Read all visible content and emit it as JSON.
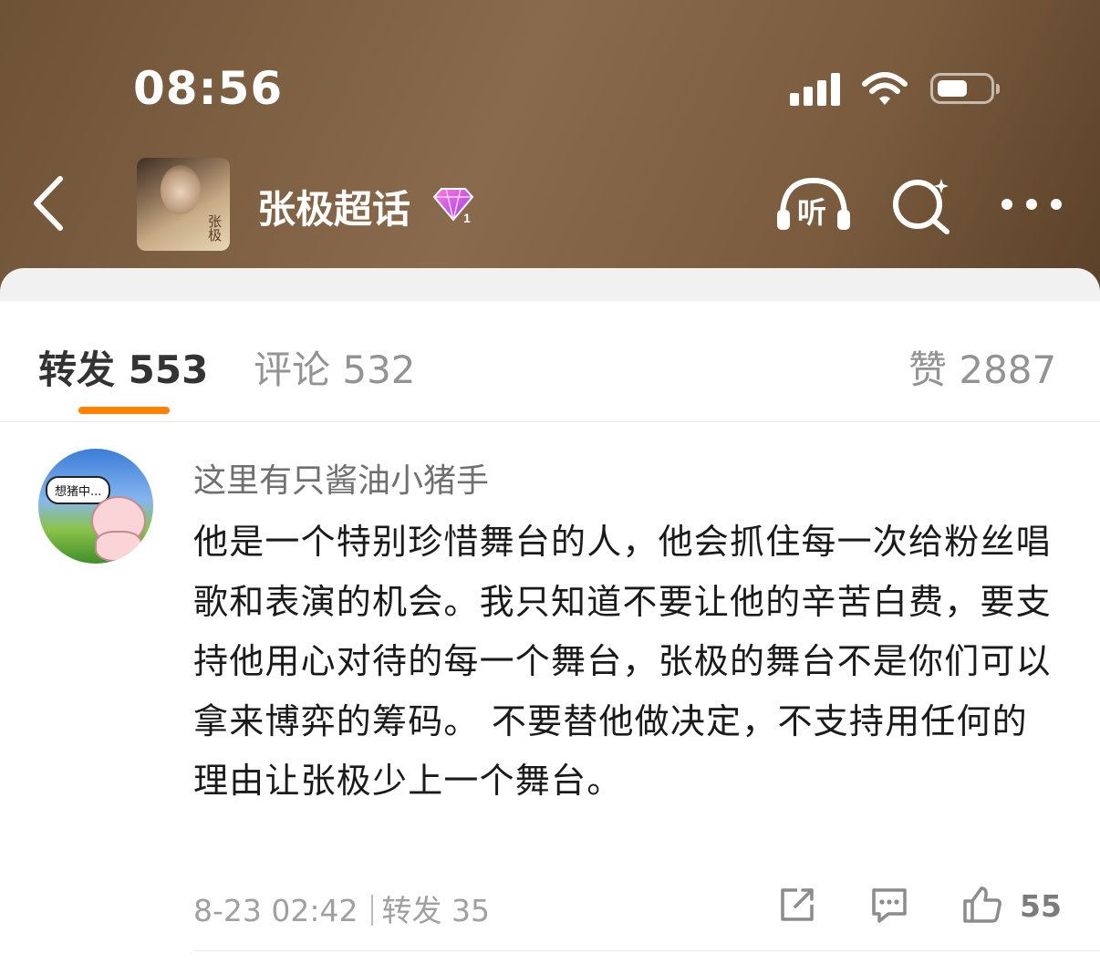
{
  "status_bar": {
    "time": "08:56"
  },
  "header": {
    "topic_title": "张极超话",
    "thumb_text": "张极",
    "icons": [
      "back-icon",
      "listen-icon",
      "search-icon",
      "more-icon",
      "gem-badge-icon"
    ],
    "listen_label": "听"
  },
  "tabs": {
    "repost": "转发 553",
    "comment": "评论 532",
    "like": "赞 2887",
    "active_color": "#ff8200"
  },
  "post": {
    "username": "这里有只酱油小猪手",
    "avatar_bubble": "想猪中...",
    "text": "他是一个特别珍惜舞台的人，他会抓住每一次给粉丝唱歌和表演的机会。我只知道不要让他的辛苦白费，要支持他用心对待的每一个舞台，张极的舞台不是你们可以拿来博弈的筹码。 不要替他做决定，不支持用任何的理由让张极少上一个舞台。",
    "timestamp": "8-23 02:42",
    "repost_info": "转发 35",
    "like_count": "55"
  }
}
